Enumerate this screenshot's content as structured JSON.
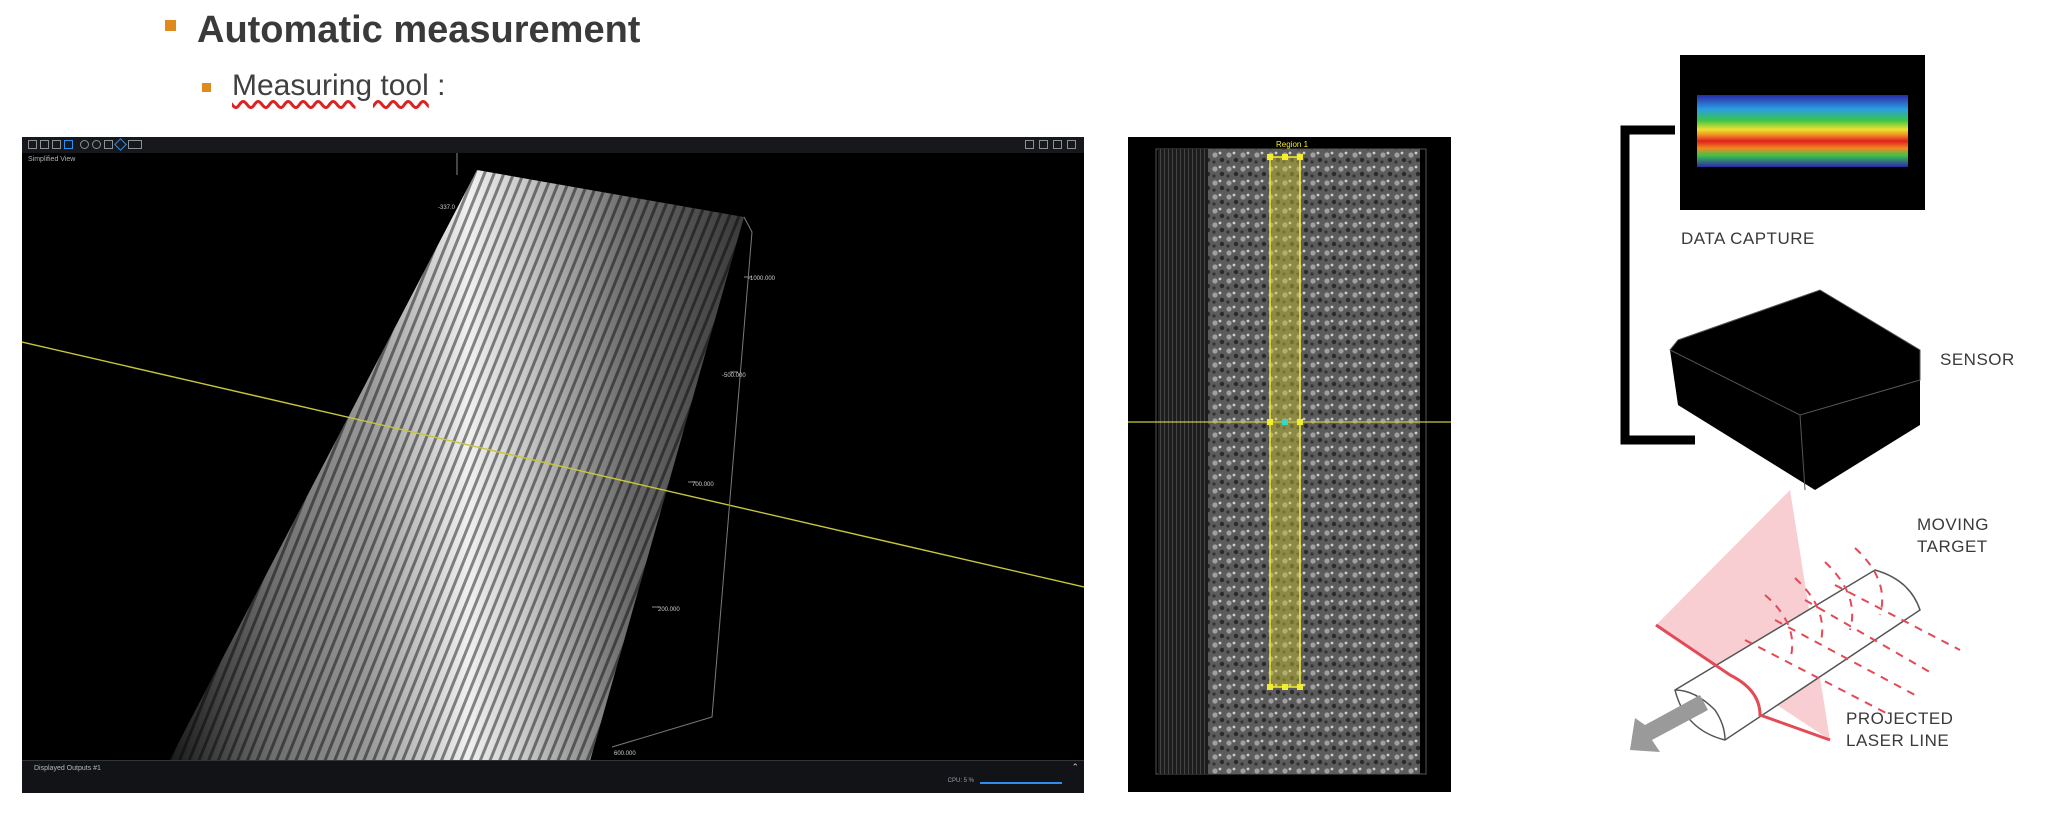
{
  "slide": {
    "heading": "Automatic measurement",
    "subheading_underlined": "Measuring tool",
    "subheading_suffix": " :"
  },
  "viewer": {
    "view_label": "Simplified View",
    "axis_labels": [
      "-337.0",
      "-1000.000",
      "-500.000",
      "700.000",
      "200.000",
      "600.000"
    ],
    "status_label": "Displayed Outputs #1",
    "cpu_text": "CPU: 5 %",
    "toolbar_icons": [
      "grid-icon",
      "chart-icon",
      "layout-icon",
      "mountain-icon",
      "hand-icon",
      "zoom-icon",
      "color-icon",
      "camera-icon",
      "export-icon",
      "fit-icon",
      "fullscreen-icon",
      "window-icon"
    ]
  },
  "inspection": {
    "region_label": "Region 1"
  },
  "diagram": {
    "data_capture": "DATA CAPTURE",
    "sensor": "SENSOR",
    "moving_target_1": "MOVING",
    "moving_target_2": "TARGET",
    "laser_line_1": "PROJECTED",
    "laser_line_2": "LASER LINE"
  },
  "colors": {
    "bullet": "#e08a1e",
    "measure_line": "#c9c63a",
    "region": "#f2ee2f",
    "accent": "#2f8df0",
    "laser": "#e24a55"
  }
}
